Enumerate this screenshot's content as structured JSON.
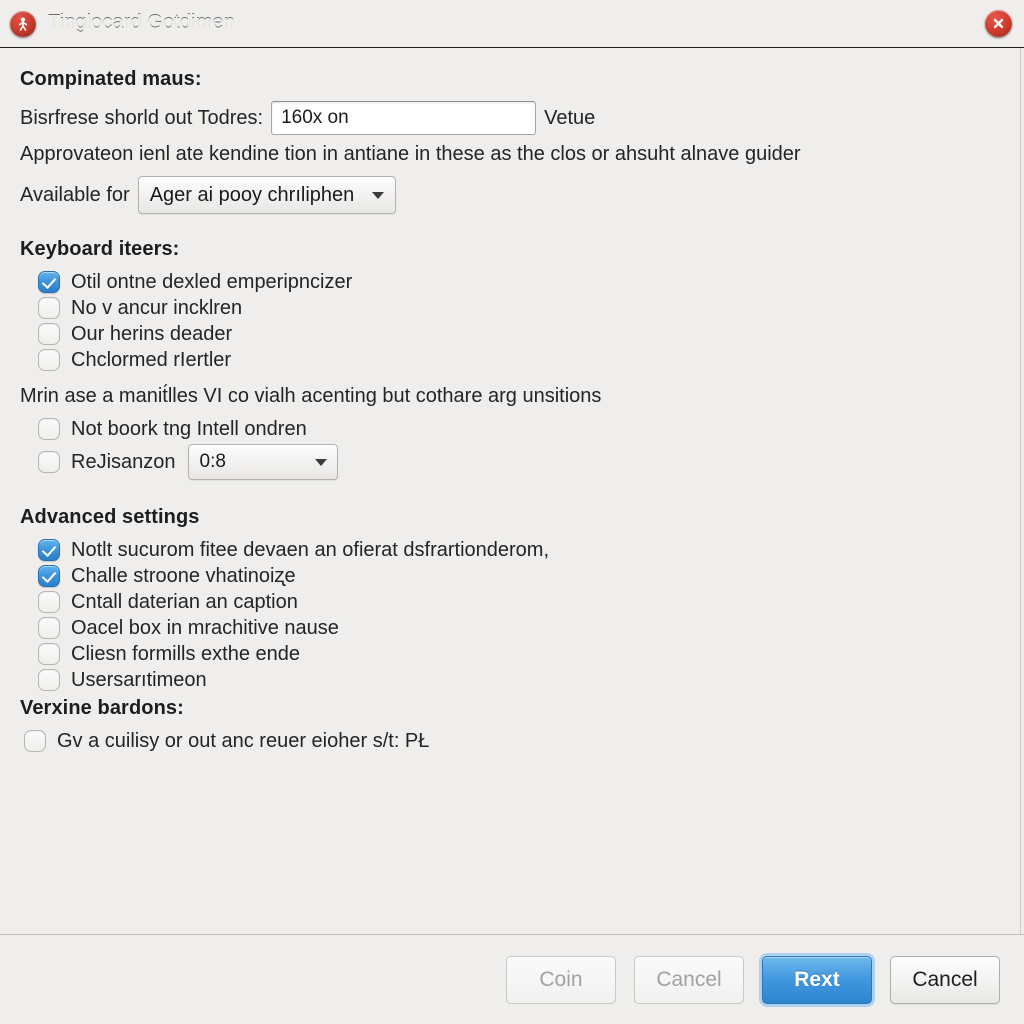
{
  "titlebar": {
    "app_icon": "person-circle-icon",
    "title": "Tinglocard Gotdimen",
    "close_icon": "close-icon"
  },
  "section1": {
    "heading": "Compinated maus:",
    "field_row": {
      "label": "Bisrfrese shorld out Todres:",
      "value": "160x on",
      "suffix": "Vetue"
    },
    "description": "Approvateon ienl ate kendine tion in antiane in these as the clos or ahsuht alnave guider",
    "available_row": {
      "label": "Available for",
      "selected": "Ager ai pooy chrıliphen"
    }
  },
  "section2": {
    "heading": "Keyboard iteers:",
    "options": [
      {
        "label": "Otil ontne dexled emperipncizer",
        "checked": true
      },
      {
        "label": "No v ancur incklren",
        "checked": false
      },
      {
        "label": "Our herins deader",
        "checked": false
      },
      {
        "label": "Chclormed rIertler",
        "checked": false
      }
    ],
    "note": "Mrin ase a manit́lles VI co vialh acenting but cothare arg unsitions",
    "sub_options": [
      {
        "label": "Not boork tng Intell ondren",
        "checked": false
      },
      {
        "label": "ReJisanzon",
        "checked": false,
        "combo": "0:8"
      }
    ]
  },
  "section3": {
    "heading": "Advanced settings",
    "options": [
      {
        "label": "Notlt sucurom fitee devaen an ofierat dsfrartionderom,",
        "checked": true
      },
      {
        "label": "Challe stroone vhatinoiʐe",
        "checked": true
      },
      {
        "label": "Cntall daterian an caption",
        "checked": false
      },
      {
        "label": "Oacel box in mrachitive nause",
        "checked": false
      },
      {
        "label": "Cliesn formills exthe ende",
        "checked": false
      },
      {
        "label": "Usersarıtimeon",
        "checked": false
      }
    ]
  },
  "section4": {
    "heading": "Verxine bardons:",
    "options": [
      {
        "label": "Gv a cuilisy or out anc reuer eioher s/t:  PŁ",
        "checked": false
      }
    ]
  },
  "footer": {
    "buttons": [
      {
        "label": "Coin",
        "style": "disabled"
      },
      {
        "label": "Cancel",
        "style": "disabled"
      },
      {
        "label": "Rext",
        "style": "primary"
      },
      {
        "label": "Cancel",
        "style": "normal"
      }
    ]
  },
  "colors": {
    "titlebar": "#403d38",
    "window_bg": "#efeeec",
    "accent_blue": "#3b92da",
    "primary_button": "#449ae0",
    "close_red": "#cc3b2d"
  }
}
